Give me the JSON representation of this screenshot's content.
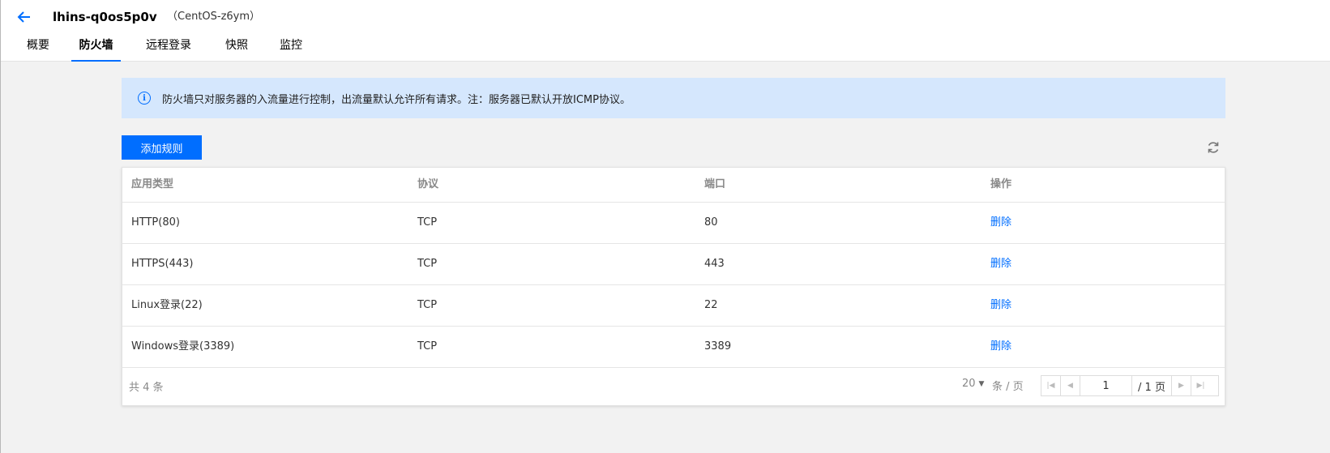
{
  "header": {
    "title": "lhins-q0os5p0v",
    "subtitle": "（CentOS-z6ym）"
  },
  "tabs": [
    {
      "label": "概要",
      "active": false
    },
    {
      "label": "防火墙",
      "active": true
    },
    {
      "label": "远程登录",
      "active": false
    },
    {
      "label": "快照",
      "active": false
    },
    {
      "label": "监控",
      "active": false
    }
  ],
  "notice": {
    "icon": "info-icon",
    "text": "防火墙只对服务器的入流量进行控制，出流量默认允许所有请求。注：服务器已默认开放ICMP协议。"
  },
  "toolbar": {
    "add_rule_label": "添加规则",
    "refresh_icon": "refresh-icon"
  },
  "table": {
    "columns": [
      "应用类型",
      "协议",
      "端口",
      "操作"
    ],
    "rows": [
      {
        "app_type": "HTTP(80)",
        "protocol": "TCP",
        "port": "80",
        "action": "删除"
      },
      {
        "app_type": "HTTPS(443)",
        "protocol": "TCP",
        "port": "443",
        "action": "删除"
      },
      {
        "app_type": "Linux登录(22)",
        "protocol": "TCP",
        "port": "22",
        "action": "删除"
      },
      {
        "app_type": "Windows登录(3389)",
        "protocol": "TCP",
        "port": "3389",
        "action": "删除"
      }
    ]
  },
  "pagination": {
    "total_text": "共 4 条",
    "page_size": "20",
    "per_page_label": "条 / 页",
    "current_page": "1",
    "total_pages_text": "/ 1 页"
  },
  "colors": {
    "accent": "#006eff",
    "notice_bg": "#d5e7fd",
    "page_bg": "#f2f2f2"
  }
}
